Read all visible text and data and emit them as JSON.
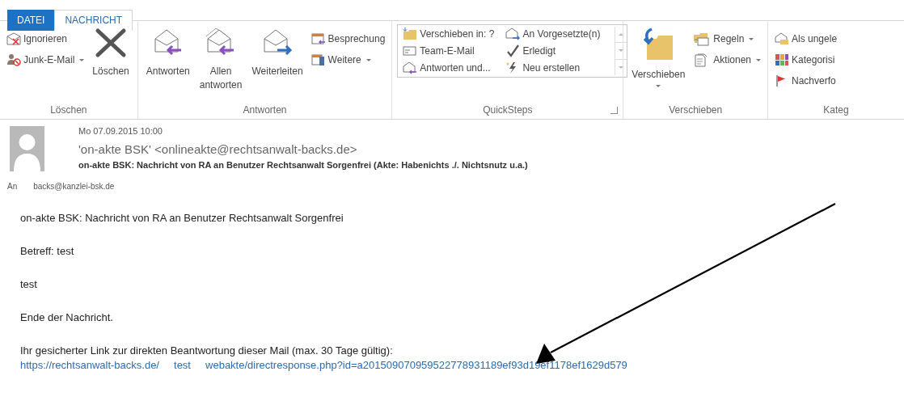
{
  "tabs": [
    {
      "label": "DATEI",
      "kind": "file",
      "selected": false
    },
    {
      "label": "NACHRICHT",
      "kind": "normal",
      "selected": true
    }
  ],
  "ribbon": {
    "groups": [
      {
        "label": "Löschen",
        "columns": [
          [
            {
              "label": "Ignorieren",
              "kind": "small",
              "dropdown": false
            },
            {
              "label": "Junk-E-Mail",
              "kind": "small",
              "dropdown": true
            }
          ],
          [
            {
              "label": "Löschen",
              "kind": "large",
              "dropdown": false
            }
          ]
        ]
      },
      {
        "label": "Antworten",
        "columns": [
          [
            {
              "label": "Antworten",
              "kind": "large",
              "dropdown": false
            }
          ],
          [
            {
              "label": "Allen antworten",
              "kind": "large",
              "dropdown": false
            }
          ],
          [
            {
              "label": "Weiterleiten",
              "kind": "large",
              "dropdown": false
            }
          ],
          [
            {
              "label": "Besprechung",
              "kind": "small",
              "dropdown": false
            },
            {
              "label": "Weitere",
              "kind": "small",
              "dropdown": true
            }
          ]
        ]
      },
      {
        "label": "QuickSteps",
        "launcher": true,
        "gallery": true,
        "columns": [
          [
            {
              "label": "Verschieben in: ?",
              "kind": "small",
              "dropdown": false
            },
            {
              "label": "Team-E-Mail",
              "kind": "small",
              "dropdown": false
            },
            {
              "label": "Antworten und...",
              "kind": "small",
              "dropdown": false
            }
          ],
          [
            {
              "label": "An Vorgesetzte(n)",
              "kind": "small",
              "dropdown": false
            },
            {
              "label": "Erledigt",
              "kind": "small",
              "dropdown": false
            },
            {
              "label": "Neu erstellen",
              "kind": "small",
              "dropdown": false
            }
          ]
        ]
      },
      {
        "label": "Verschieben",
        "columns": [
          [
            {
              "label": "Verschieben",
              "kind": "large",
              "dropdown": true
            }
          ],
          [
            {
              "label": "Regeln",
              "kind": "small",
              "dropdown": true
            },
            {
              "label": "Aktionen",
              "kind": "small",
              "dropdown": true
            }
          ]
        ]
      },
      {
        "label": "Kateg",
        "columns": [
          [
            {
              "label": "Als ungele",
              "kind": "small",
              "dropdown": false
            },
            {
              "label": "Kategorisi",
              "kind": "small",
              "dropdown": false
            },
            {
              "label": "Nachverfo",
              "kind": "small",
              "dropdown": false
            }
          ]
        ]
      }
    ]
  },
  "message": {
    "date": "Mo 07.09.2015 10:00",
    "sender": "'on-akte BSK' <onlineakte@rechtsanwalt-backs.de>",
    "subject": "on-akte BSK: Nachricht von RA an Benutzer Rechtsanwalt Sorgenfrei (Akte: Habenichts ./. Nichtsnutz u.a.)",
    "to_label": "An",
    "to": "backs@kanzlei-bsk.de"
  },
  "body": [
    {
      "kind": "text",
      "text": "on-akte BSK: Nachricht von RA an Benutzer Rechtsanwalt Sorgenfrei"
    },
    {
      "kind": "text",
      "text": "Betreff: test"
    },
    {
      "kind": "text",
      "text": "test"
    },
    {
      "kind": "text",
      "text": "Ende der Nachricht."
    },
    {
      "kind": "text",
      "text": "Ihr gesicherter Link zur direkten Beantwortung dieser Mail (max. 30 Tage gültig):"
    },
    {
      "kind": "link",
      "text": "https://rechtsanwalt-backs.de/     test     webakte/directresponse.php?id=a201509070959522778931189ef93d19ef1178ef1629d579"
    }
  ],
  "annotation": {
    "arrow": true
  }
}
